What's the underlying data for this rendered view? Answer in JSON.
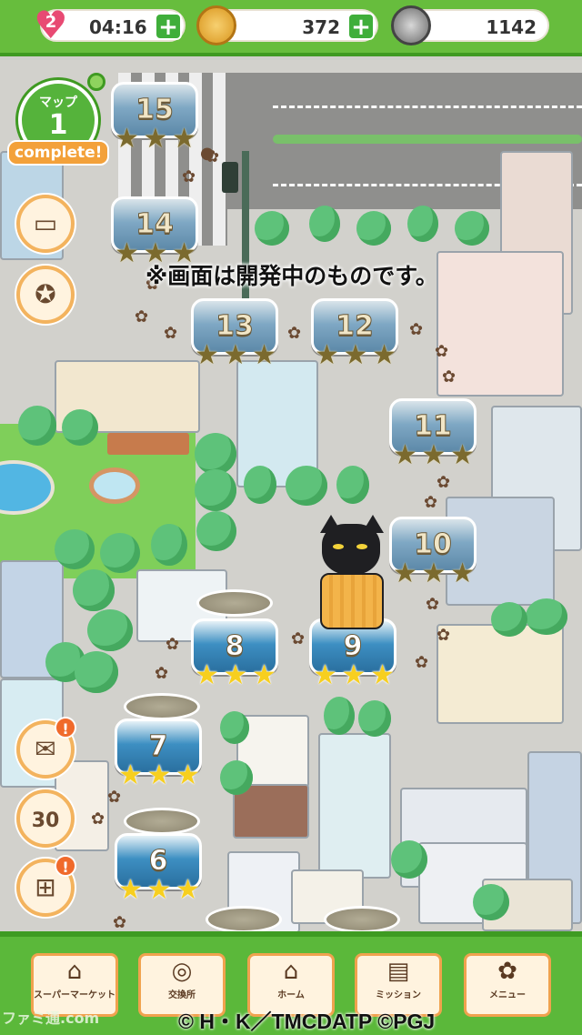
{
  "status_bar": {
    "lives": "2",
    "timer": "04:16",
    "coins": "372",
    "cans": "1142"
  },
  "map_badge": {
    "line1": "マップ",
    "number": "1",
    "status": "complete!"
  },
  "notice": "※画面は開発中のものです。",
  "stages": [
    {
      "number": "15",
      "stars_earned": 3,
      "style": "dark"
    },
    {
      "number": "14",
      "stars_earned": 3,
      "style": "dark"
    },
    {
      "number": "13",
      "stars_earned": 3,
      "style": "dark"
    },
    {
      "number": "12",
      "stars_earned": 3,
      "style": "dark"
    },
    {
      "number": "11",
      "stars_earned": 3,
      "style": "dark"
    },
    {
      "number": "10",
      "stars_earned": 3,
      "style": "dark"
    },
    {
      "number": "9",
      "stars_earned": 3,
      "style": "gold"
    },
    {
      "number": "8",
      "stars_earned": 3,
      "style": "gold"
    },
    {
      "number": "7",
      "stars_earned": 3,
      "style": "gold"
    },
    {
      "number": "6",
      "stars_earned": 3,
      "style": "gold"
    }
  ],
  "side_buttons": {
    "book_badge": "",
    "mail_badge": "!",
    "daily_label": "30",
    "gift_badge": "!"
  },
  "nav": [
    {
      "label": "スーパーマーケット",
      "icon": "store-icon"
    },
    {
      "label": "交換所",
      "icon": "exchange-icon"
    },
    {
      "label": "ホーム",
      "icon": "home-icon"
    },
    {
      "label": "ミッション",
      "icon": "clipboard-icon"
    },
    {
      "label": "メニュー",
      "icon": "paw-icon"
    }
  ],
  "watermark_left": "ファミ通.com",
  "copyright": "© H・K／TMCDATP ©PGJ",
  "colors": {
    "accent_green": "#67bd3d",
    "button_orange": "#f0a24e",
    "star_gold": "#f7cf1f"
  }
}
